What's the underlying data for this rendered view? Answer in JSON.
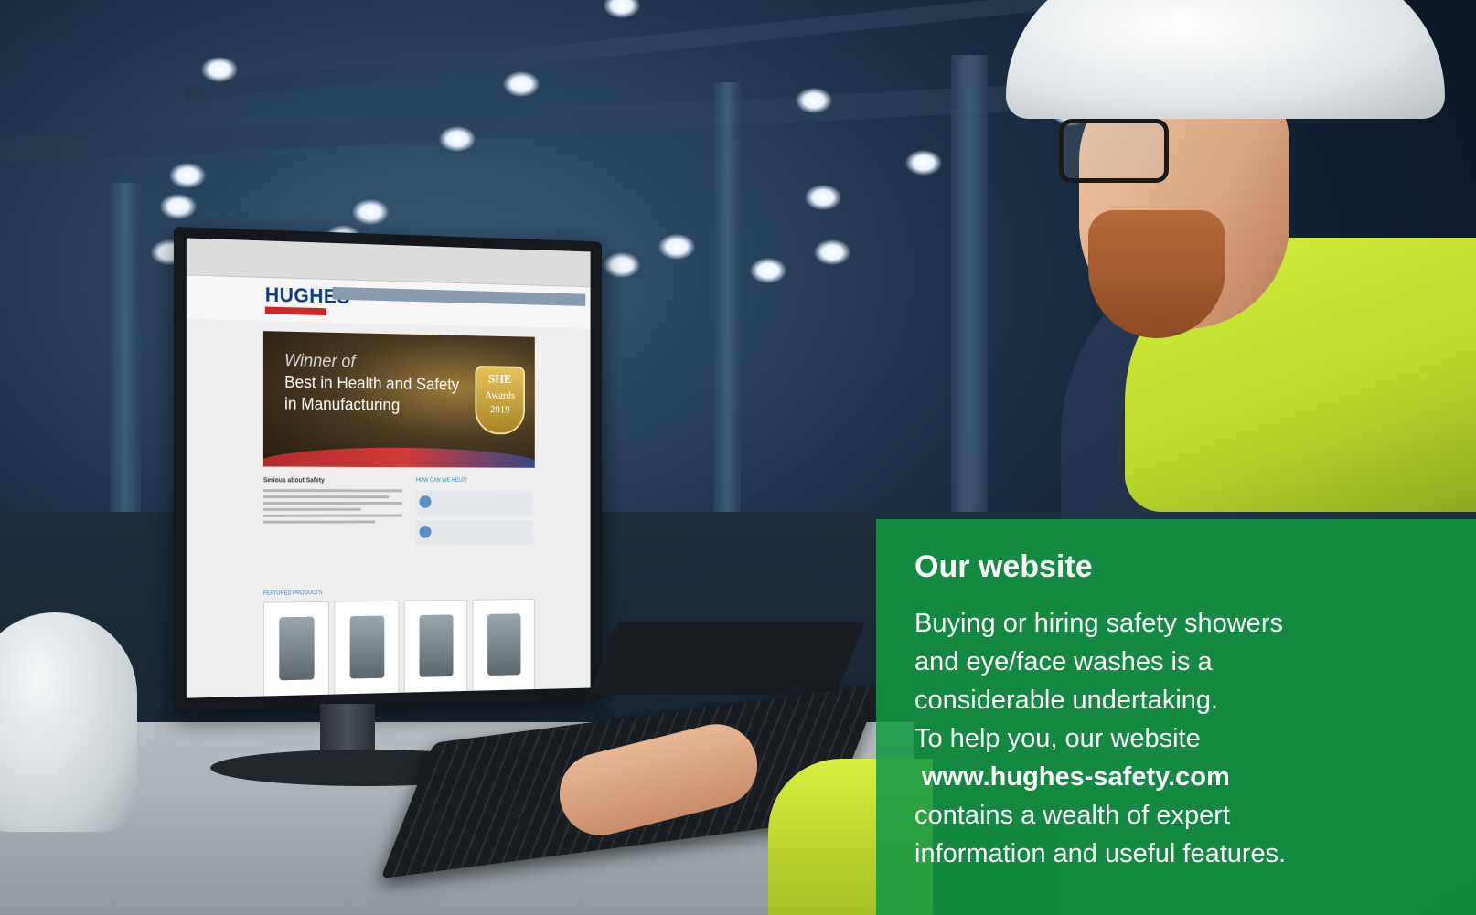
{
  "site_screen": {
    "logo": "HUGHES",
    "hero_line1": "Winner of",
    "hero_line2": "Best in Health and Safety",
    "hero_line3": "in Manufacturing",
    "badge_she": "SHE",
    "badge_awards": "Awards",
    "badge_year": "2019",
    "content_heading": "Serious about Safety",
    "help_heading": "HOW CAN WE HELP?",
    "products_heading": "FEATURED PRODUCTS"
  },
  "info_panel": {
    "title": "Our website",
    "body_lines": [
      "Buying or hiring safety showers",
      "and eye/face washes is a",
      "considerable undertaking.",
      "To help you, our website"
    ],
    "link": "www.hughes-safety.com",
    "closing_lines": [
      "contains a wealth of expert",
      "information and useful features."
    ],
    "background_color": "#129942"
  }
}
